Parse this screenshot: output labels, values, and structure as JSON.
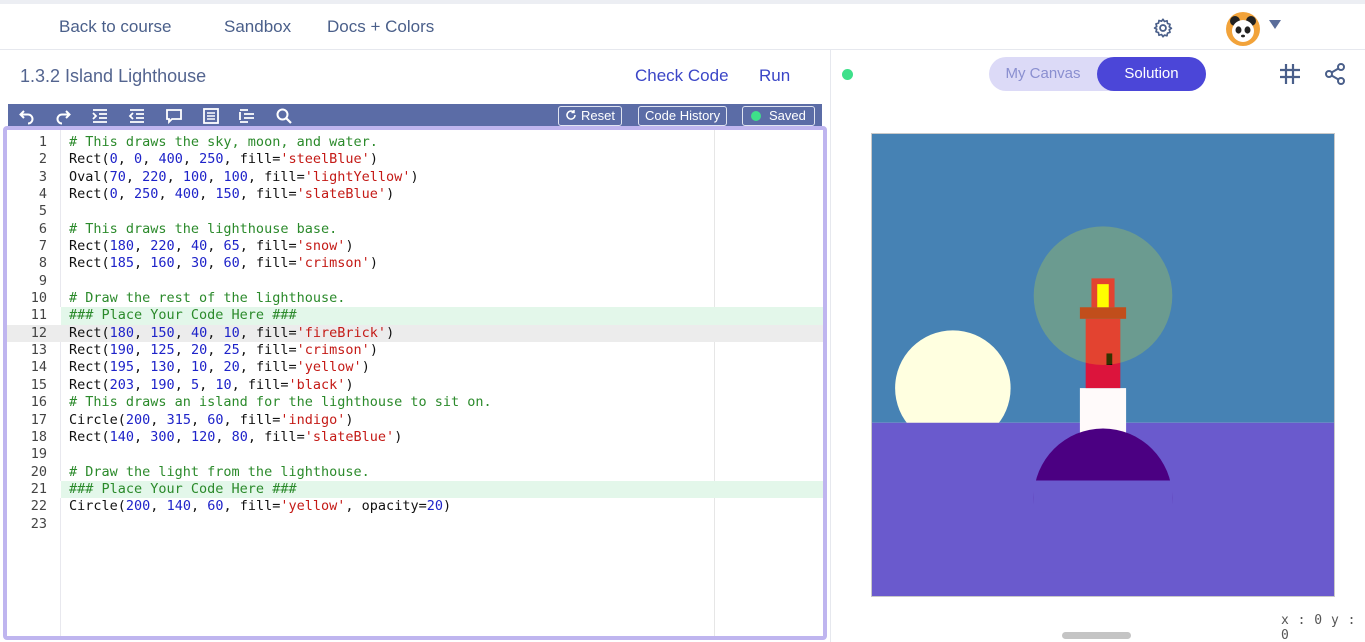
{
  "nav": {
    "back": "Back to course",
    "sandbox": "Sandbox",
    "docs": "Docs + Colors"
  },
  "header": {
    "title": "1.3.2 Island Lighthouse",
    "check_code": "Check Code",
    "run": "Run"
  },
  "toolbar": {
    "icons": [
      "undo-icon",
      "redo-icon",
      "indent-icon",
      "outdent-icon",
      "comment-icon",
      "format-icon",
      "fold-icon",
      "search-icon"
    ],
    "reset": "Reset",
    "code_history": "Code History",
    "saved": "Saved"
  },
  "editor": {
    "lines": [
      "# This draws the sky, moon, and water.",
      "Rect(0, 0, 400, 250, fill='steelBlue')",
      "Oval(70, 220, 100, 100, fill='lightYellow')",
      "Rect(0, 250, 400, 150, fill='slateBlue')",
      "",
      "# This draws the lighthouse base.",
      "Rect(180, 220, 40, 65, fill='snow')",
      "Rect(185, 160, 30, 60, fill='crimson')",
      "",
      "# Draw the rest of the lighthouse.",
      "### Place Your Code Here ###",
      "Rect(180, 150, 40, 10, fill='fireBrick')",
      "Rect(190, 125, 20, 25, fill='crimson')",
      "Rect(195, 130, 10, 20, fill='yellow')",
      "Rect(203, 190, 5, 10, fill='black')",
      "# This draws an island for the lighthouse to sit on.",
      "Circle(200, 315, 60, fill='indigo')",
      "Rect(140, 300, 120, 80, fill='slateBlue')",
      "",
      "# Draw the light from the lighthouse.",
      "### Place Your Code Here ###",
      "Circle(200, 140, 60, fill='yellow', opacity=20)",
      ""
    ],
    "green_highlight_lines": [
      11,
      21
    ],
    "active_line": 12
  },
  "right": {
    "tab_my_canvas": "My Canvas",
    "tab_solution": "Solution",
    "coords": "x : 0  y : 0"
  },
  "colors": {
    "accent": "#4b46d8",
    "steelBlue": "#4682b4",
    "slateBlue": "#6a5acd",
    "lightYellow": "#ffffe0",
    "snow": "#fffafa",
    "crimson": "#dc143c",
    "fireBrick": "#b22222",
    "yellow": "#ffff00",
    "indigo": "#4b0082"
  }
}
